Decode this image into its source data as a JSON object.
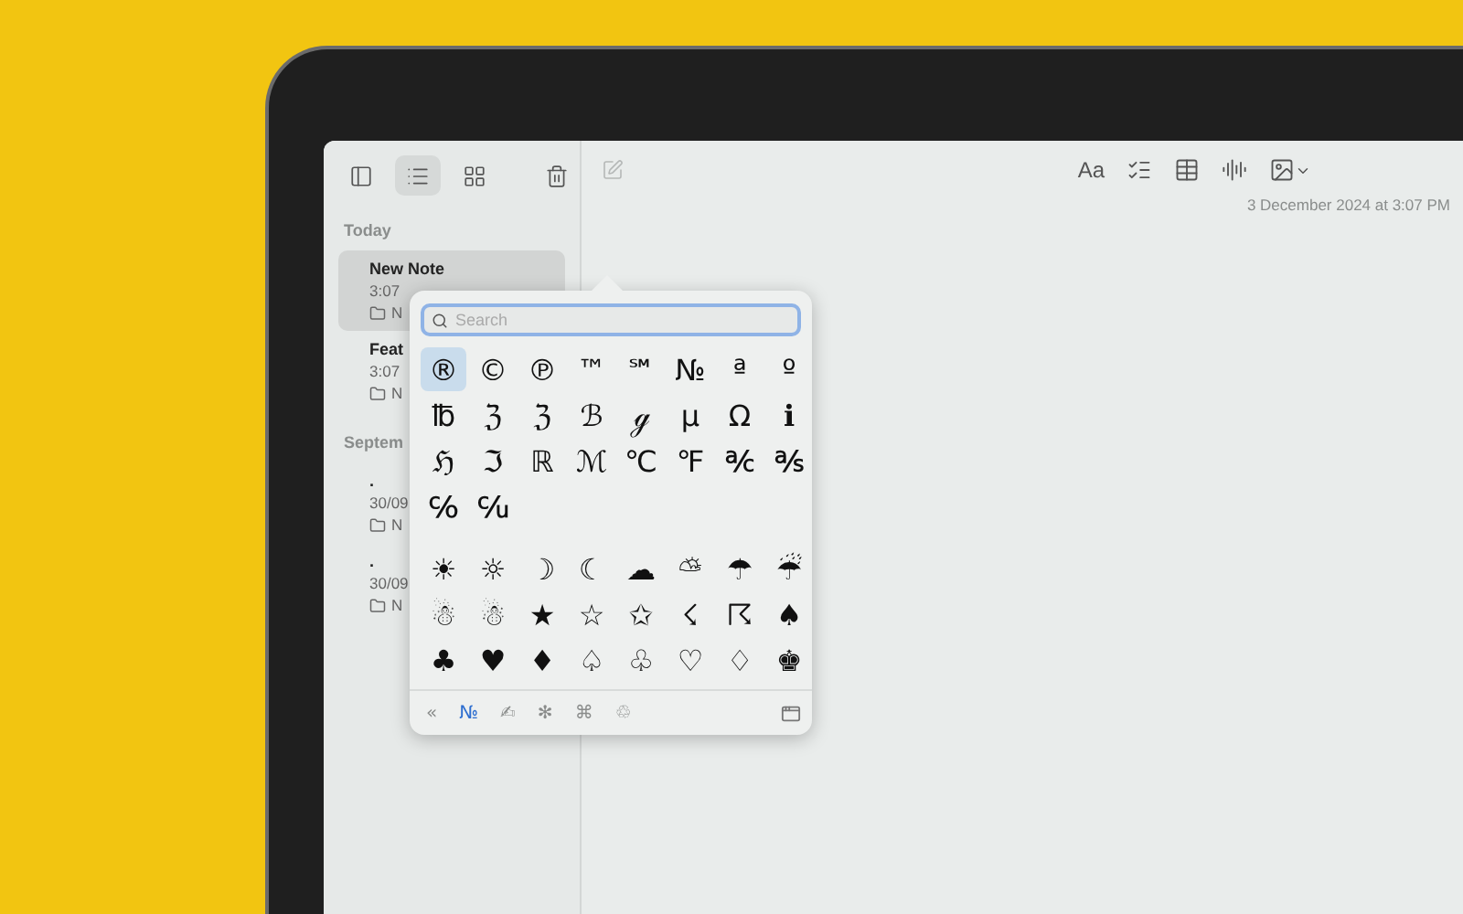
{
  "sidebar": {
    "tools": [
      {
        "kind": "sidebar",
        "selected": false
      },
      {
        "kind": "list",
        "selected": true
      },
      {
        "kind": "grid",
        "selected": false
      },
      {
        "kind": "trash",
        "selected": false
      }
    ],
    "sections": [
      {
        "title": "Today",
        "notes": [
          {
            "title": "New Note",
            "time": "3:07",
            "folder": "N",
            "selected": true
          },
          {
            "title": "Feat",
            "time": "3:07",
            "folder": "N",
            "selected": false
          }
        ]
      },
      {
        "title": "Septem",
        "notes": [
          {
            "title": ".",
            "time": "30/09",
            "folder": "N",
            "selected": false
          },
          {
            "title": ".",
            "time": "30/09",
            "folder": "N",
            "selected": false
          }
        ]
      }
    ]
  },
  "editor": {
    "compose_disabled": true,
    "format_label": "Aa",
    "date": "3 December 2024 at 3:07 PM"
  },
  "character_viewer": {
    "search": {
      "placeholder": "Search"
    },
    "groups": [
      [
        {
          "char": "®",
          "selected": true
        },
        {
          "char": "©",
          "selected": false
        },
        {
          "char": "℗",
          "selected": false
        },
        {
          "char": "™",
          "selected": false
        },
        {
          "char": "℠",
          "selected": false
        },
        {
          "char": "№",
          "selected": false
        },
        {
          "char": "ª",
          "selected": false
        },
        {
          "char": "º",
          "selected": false
        },
        {
          "char": "℔",
          "selected": false
        },
        {
          "char": "ℨ",
          "selected": false
        },
        {
          "char": "ℨ",
          "selected": false
        },
        {
          "char": "ℬ",
          "selected": false
        },
        {
          "char": "ℊ",
          "selected": false
        },
        {
          "char": "µ",
          "selected": false
        },
        {
          "char": "Ω",
          "selected": false
        },
        {
          "char": "ℹ",
          "selected": false
        },
        {
          "char": "ℌ",
          "selected": false
        },
        {
          "char": "ℑ",
          "selected": false
        },
        {
          "char": "ℝ",
          "selected": false
        },
        {
          "char": "ℳ",
          "selected": false
        },
        {
          "char": "℃",
          "selected": false
        },
        {
          "char": "℉",
          "selected": false
        },
        {
          "char": "℀",
          "selected": false
        },
        {
          "char": "℁",
          "selected": false
        },
        {
          "char": "℅",
          "selected": false
        },
        {
          "char": "℆",
          "selected": false
        }
      ],
      [
        {
          "char": "☀",
          "selected": false
        },
        {
          "char": "☼",
          "selected": false
        },
        {
          "char": "☽",
          "selected": false
        },
        {
          "char": "☾",
          "selected": false
        },
        {
          "char": "☁",
          "selected": false
        },
        {
          "char": "⛅",
          "selected": false
        },
        {
          "char": "☂",
          "selected": false
        },
        {
          "char": "☔",
          "selected": false
        },
        {
          "char": "☃",
          "selected": false
        },
        {
          "char": "☃",
          "selected": false
        },
        {
          "char": "★",
          "selected": false
        },
        {
          "char": "☆",
          "selected": false
        },
        {
          "char": "✩",
          "selected": false
        },
        {
          "char": "☇",
          "selected": false
        },
        {
          "char": "☈",
          "selected": false
        },
        {
          "char": "♠",
          "selected": false
        },
        {
          "char": "♣",
          "selected": false
        },
        {
          "char": "♥",
          "selected": false
        },
        {
          "char": "♦",
          "selected": false
        },
        {
          "char": "♤",
          "selected": false
        },
        {
          "char": "♧",
          "selected": false
        },
        {
          "char": "♡",
          "selected": false
        },
        {
          "char": "♢",
          "selected": false
        },
        {
          "char": "♚",
          "selected": false
        }
      ]
    ],
    "categories": [
      {
        "label": "«",
        "selected": false
      },
      {
        "label": "№",
        "selected": true
      },
      {
        "label": "✍",
        "selected": false
      },
      {
        "label": "✻",
        "selected": false
      },
      {
        "label": "⌘",
        "selected": false
      },
      {
        "label": "♲",
        "selected": false
      }
    ]
  }
}
